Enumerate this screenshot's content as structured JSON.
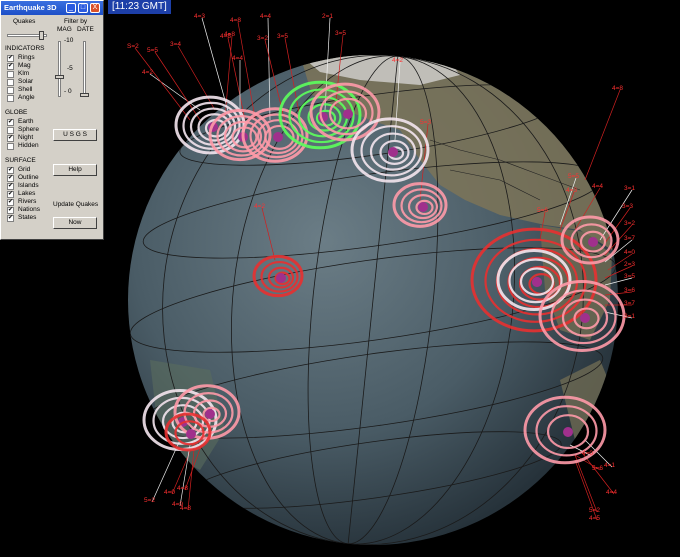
{
  "app": {
    "title": "Earthquake 3D",
    "clock": "[11:23 GMT]",
    "window_buttons": [
      "_",
      "□",
      "X"
    ]
  },
  "panel": {
    "quakes_label": "Quakes",
    "filter_label": "Filter by",
    "mag_label": "MAG",
    "date_label": "DATE",
    "scale": [
      "-10",
      "-5",
      "- 0"
    ],
    "indicators_header": "INDICATORS",
    "indicators": [
      {
        "label": "Rings",
        "checked": true
      },
      {
        "label": "Mag",
        "checked": true
      },
      {
        "label": "Klm",
        "checked": false
      },
      {
        "label": "Solar",
        "checked": false
      },
      {
        "label": "Shell",
        "checked": false
      },
      {
        "label": "Angle",
        "checked": false
      }
    ],
    "globe_header": "GLOBE",
    "globe": [
      {
        "label": "Earth",
        "checked": true
      },
      {
        "label": "Sphere",
        "checked": false
      },
      {
        "label": "Night",
        "checked": true
      },
      {
        "label": "Hidden",
        "checked": false
      }
    ],
    "surface_header": "SURFACE",
    "surface": [
      {
        "label": "Grid",
        "checked": true
      },
      {
        "label": "Outline",
        "checked": true
      },
      {
        "label": "Islands",
        "checked": true
      },
      {
        "label": "Lakes",
        "checked": true
      },
      {
        "label": "Rivers",
        "checked": true
      },
      {
        "label": "Nations",
        "checked": true
      },
      {
        "label": "States",
        "checked": true
      }
    ],
    "usgs_button": "U S G S",
    "help_button": "Help",
    "update_label_1": "Update Quakes",
    "now_button": "Now"
  },
  "colors": {
    "background": "#000000",
    "ocean": "#4a5c66",
    "ring_white": "#f4e6ee",
    "ring_pink": "#ff9aa8",
    "ring_red": "#e83030",
    "ring_green": "#5cff5c",
    "epicenter": "#a0308c",
    "leader_line": "#d02020"
  },
  "quake_labels": [
    "4=2",
    "3=4",
    "S=2",
    "4=3",
    "4=8",
    "4=8",
    "4=4",
    "3=2",
    "3=5",
    "2=1",
    "3=5",
    "5=5",
    "4=2",
    "5=3",
    "4=8",
    "3=1",
    "3=3",
    "3=2",
    "3=7",
    "4=0",
    "2=3",
    "3=5",
    "3=6",
    "3=7",
    "3=1",
    "4=3",
    "5=6",
    "5=2",
    "4=0",
    "4=8",
    "4=9",
    "4=8",
    "4=4",
    "4=1",
    "4=5",
    "5=2",
    "4=0",
    "5=6",
    "4=8",
    "4=4",
    "4=2",
    "4=4",
    "5=5"
  ]
}
